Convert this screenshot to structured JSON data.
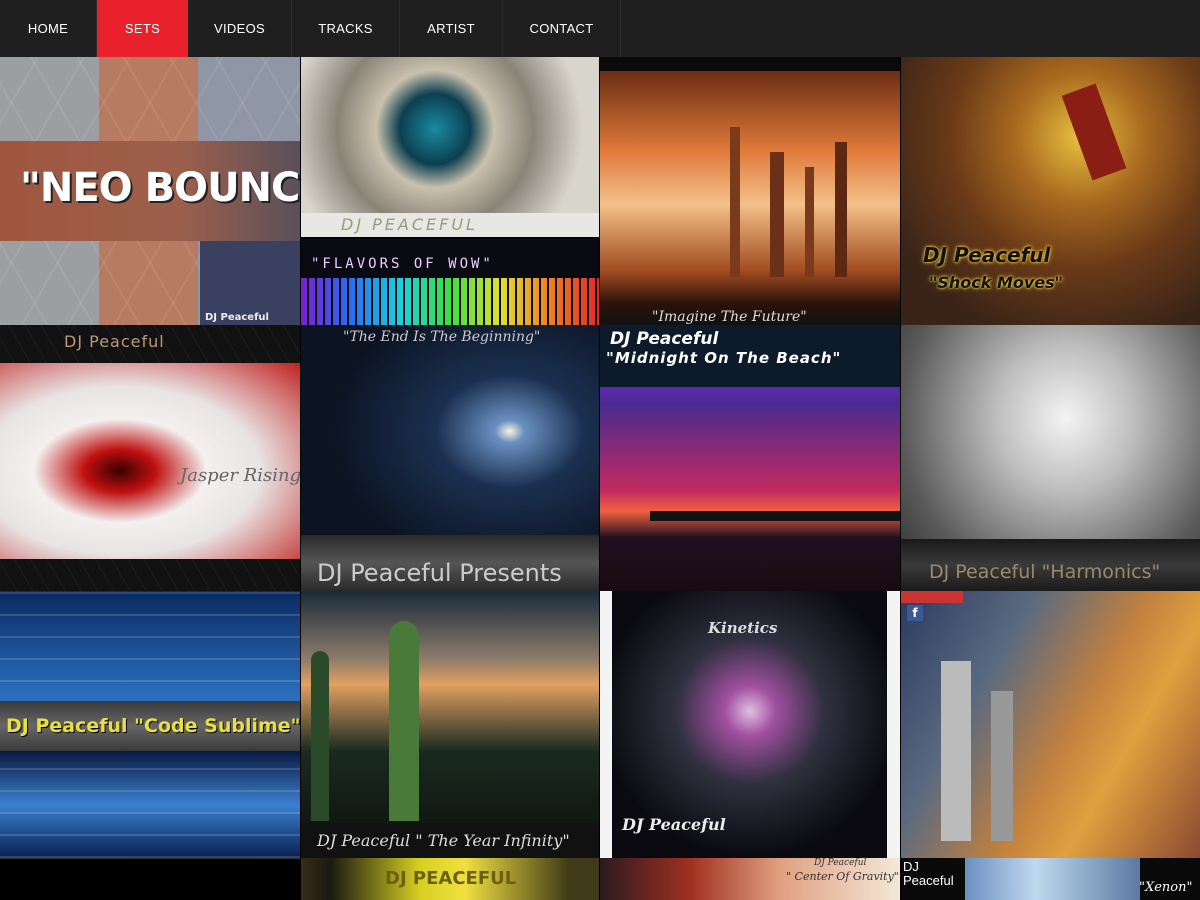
{
  "nav": {
    "items": [
      {
        "label": "HOME",
        "active": false
      },
      {
        "label": "SETS",
        "active": true
      },
      {
        "label": "VIDEOS",
        "active": false
      },
      {
        "label": "TRACKS",
        "active": false
      },
      {
        "label": "ARTIST",
        "active": false
      },
      {
        "label": "CONTACT",
        "active": false
      }
    ]
  },
  "colors": {
    "nav_bg": "#1f1f1f",
    "active": "#e8212c",
    "text": "#ffffff"
  },
  "tiles": [
    {
      "name": "neo-bounce",
      "caption": "\"NEO BOUNCE\"",
      "sub": "DJ Peaceful"
    },
    {
      "name": "dj-peaceful-liquid",
      "caption": "DJ PEACEFUL"
    },
    {
      "name": "imagine-the-future",
      "caption": "\"Imagine The Future\""
    },
    {
      "name": "shock-moves",
      "caption": "DJ Peaceful",
      "sub": "\"Shock Moves\""
    },
    {
      "name": "flavors-of-wow",
      "caption": "\"FLAVORS OF WOW\""
    },
    {
      "name": "jasper-rising",
      "caption": "DJ Peaceful",
      "sub": "Jasper Rising"
    },
    {
      "name": "the-end-is-the-beginning",
      "caption": "\"The End Is The Beginning\"",
      "sub": "DJ Peaceful Presents"
    },
    {
      "name": "midnight-on-the-beach",
      "caption": "DJ Peaceful",
      "sub": "\"Midnight On The Beach\""
    },
    {
      "name": "harmonics",
      "caption": "DJ Peaceful \"Harmonics\""
    },
    {
      "name": "code-sublime",
      "caption": "DJ Peaceful \"Code Sublime\""
    },
    {
      "name": "the-year-infinity",
      "caption": "DJ Peaceful  \" The Year Infinity\""
    },
    {
      "name": "kinetics",
      "caption": "Kinetics",
      "sub": "DJ Peaceful"
    },
    {
      "name": "lion-city",
      "caption": "f"
    },
    {
      "name": "black-tile",
      "caption": ""
    },
    {
      "name": "dj-peaceful-gold",
      "caption": "DJ PEACEFUL"
    },
    {
      "name": "center-of-gravity",
      "caption": "DJ Peaceful",
      "sub": "\" Center Of Gravity\""
    },
    {
      "name": "xenon",
      "caption": "DJ Peaceful",
      "sub": "\"Xenon\""
    }
  ]
}
